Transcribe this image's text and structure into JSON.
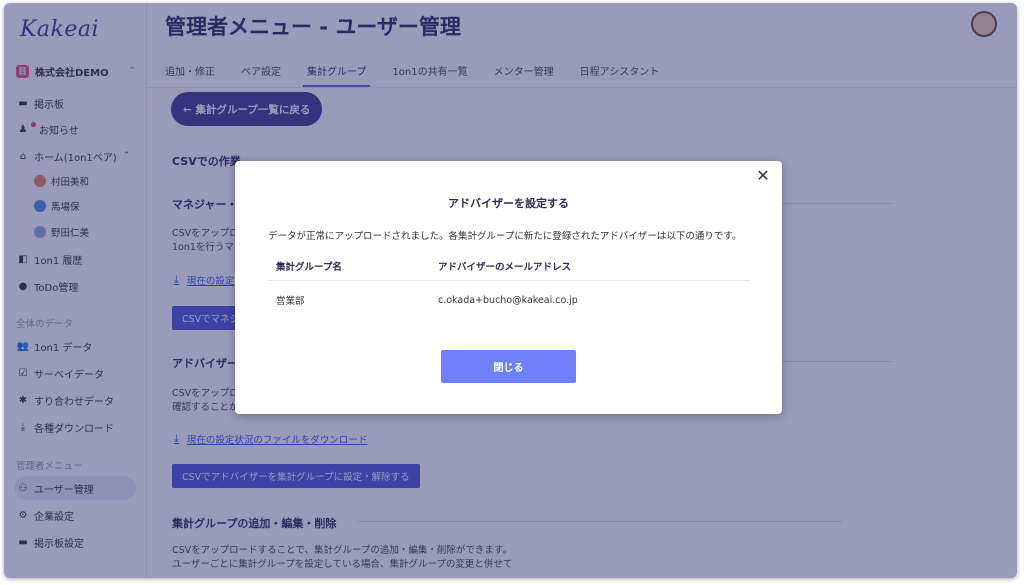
{
  "sidebar": {
    "logo": "Kakeai",
    "company": {
      "badge": "目",
      "name": "株式会社DEMO",
      "selector_icon": "chevron-updown-icon"
    },
    "items": [
      {
        "icon": "board-icon",
        "glyph": "▬",
        "label": "掲示板"
      },
      {
        "icon": "bell-icon",
        "glyph": "🔔",
        "label": "お知らせ"
      },
      {
        "icon": "home-icon",
        "glyph": "⌂",
        "label": "ホーム(1on1ペア)",
        "expanded_icon": "chevron-up-icon"
      },
      {
        "icon": "avatar",
        "label": "村田美和",
        "color": "#e98a5b"
      },
      {
        "icon": "avatar",
        "label": "馬場保",
        "color": "#4a8fe2"
      },
      {
        "icon": "avatar",
        "label": "野田仁美",
        "color": "#9aa7c8"
      },
      {
        "icon": "history-icon",
        "glyph": "◧",
        "label": "1on1 履歴"
      },
      {
        "icon": "check-circle-icon",
        "glyph": "✔",
        "label": "ToDo管理"
      }
    ],
    "data_section": "全体のデータ",
    "data_items": [
      {
        "icon": "people-icon",
        "glyph": "👥",
        "label": "1on1 データ"
      },
      {
        "icon": "survey-icon",
        "glyph": "☑",
        "label": "サーベイデータ"
      },
      {
        "icon": "puzzle-icon",
        "glyph": "✱",
        "label": "すり合わせデータ"
      },
      {
        "icon": "download-icon",
        "glyph": "⤓",
        "label": "各種ダウンロード"
      }
    ],
    "admin_section": "管理者メニュー",
    "admin_items": [
      {
        "icon": "user-manage-icon",
        "glyph": "⚇",
        "label": "ユーザー管理"
      },
      {
        "icon": "company-settings-icon",
        "glyph": "⚙",
        "label": "企業設定"
      },
      {
        "icon": "board-settings-icon",
        "glyph": "▬",
        "label": "掲示板設定"
      }
    ]
  },
  "header": {
    "title": "管理者メニュー - ユーザー管理"
  },
  "tabs": [
    "追加・修正",
    "ペア設定",
    "集計グループ",
    "1on1の共有一覧",
    "メンター管理",
    "日程アシスタント"
  ],
  "active_tab": "集計グループ",
  "main": {
    "back_button": "← 集計グループ一覧に戻る",
    "csv_section_title": "CSVでの作業",
    "manager": {
      "title": "マネジャー・",
      "text1": "CSVをアップロ",
      "text2": "1on1を行うマネ",
      "download_link": "現在の設定",
      "button": "CSVでマネジ"
    },
    "advisor": {
      "title": "アドバイザー",
      "text1": "CSVをアップロ",
      "text2": "確認することが",
      "download_link": "現在の設定状況のファイルをダウンロード",
      "button": "CSVでアドバイザーを集計グループに設定・解除する"
    },
    "group_section": {
      "title": "集計グループの追加・編集・削除",
      "text1": "CSVをアップロードすることで、集計グループの追加・編集・削除ができます。",
      "text2": "ユーザーごとに集計グループを設定している場合、集計グループの変更と併せて"
    }
  },
  "modal": {
    "title": "アドバイザーを設定する",
    "message": "データが正常にアップロードされました。各集計グループに新たに登録されたアドバイザーは以下の通りです。",
    "columns": [
      "集計グループ名",
      "アドバイザーのメールアドレス"
    ],
    "rows": [
      {
        "group": "営業部",
        "email": "c.okada+bucho@kakeai.co.jp"
      }
    ],
    "close_button": "閉じる"
  },
  "colors": {
    "primary": "#4f5bd5",
    "brand_dark": "#3d3f8a",
    "overlay": "#28286e",
    "modal_button": "#6f80f8"
  }
}
